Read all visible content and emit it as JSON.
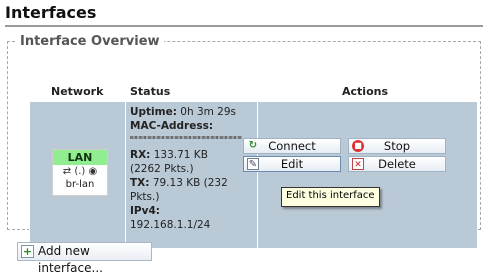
{
  "page": {
    "title": "Interfaces"
  },
  "overview": {
    "legend": "Interface Overview",
    "columns": {
      "network": "Network",
      "status": "Status",
      "actions": "Actions"
    },
    "interface": {
      "name": "LAN",
      "icons_text": "(.)",
      "device": "br-lan",
      "badge_color": "#90ee90",
      "status": {
        "uptime_label": "Uptime:",
        "uptime_value": "0h 3m 29s",
        "mac_label": "MAC-Address:",
        "rx_label": "RX:",
        "rx_value": "133.71 KB",
        "rx_pkts": "(2262 Pkts.)",
        "tx_label": "TX:",
        "tx_value": "79.13 KB (232",
        "tx_pkts": "Pkts.)",
        "ipv4_label": "IPv4:",
        "ipv4_value": "192.168.1.1/24"
      },
      "actions": {
        "connect": "Connect",
        "edit": "Edit",
        "stop": "Stop",
        "delete": "Delete",
        "edit_tooltip": "Edit this interface"
      }
    }
  },
  "add_button": {
    "label": "Add new interface..."
  },
  "colors": {
    "row_bg": "#bac9d6",
    "tooltip_bg": "#ffffe1"
  }
}
